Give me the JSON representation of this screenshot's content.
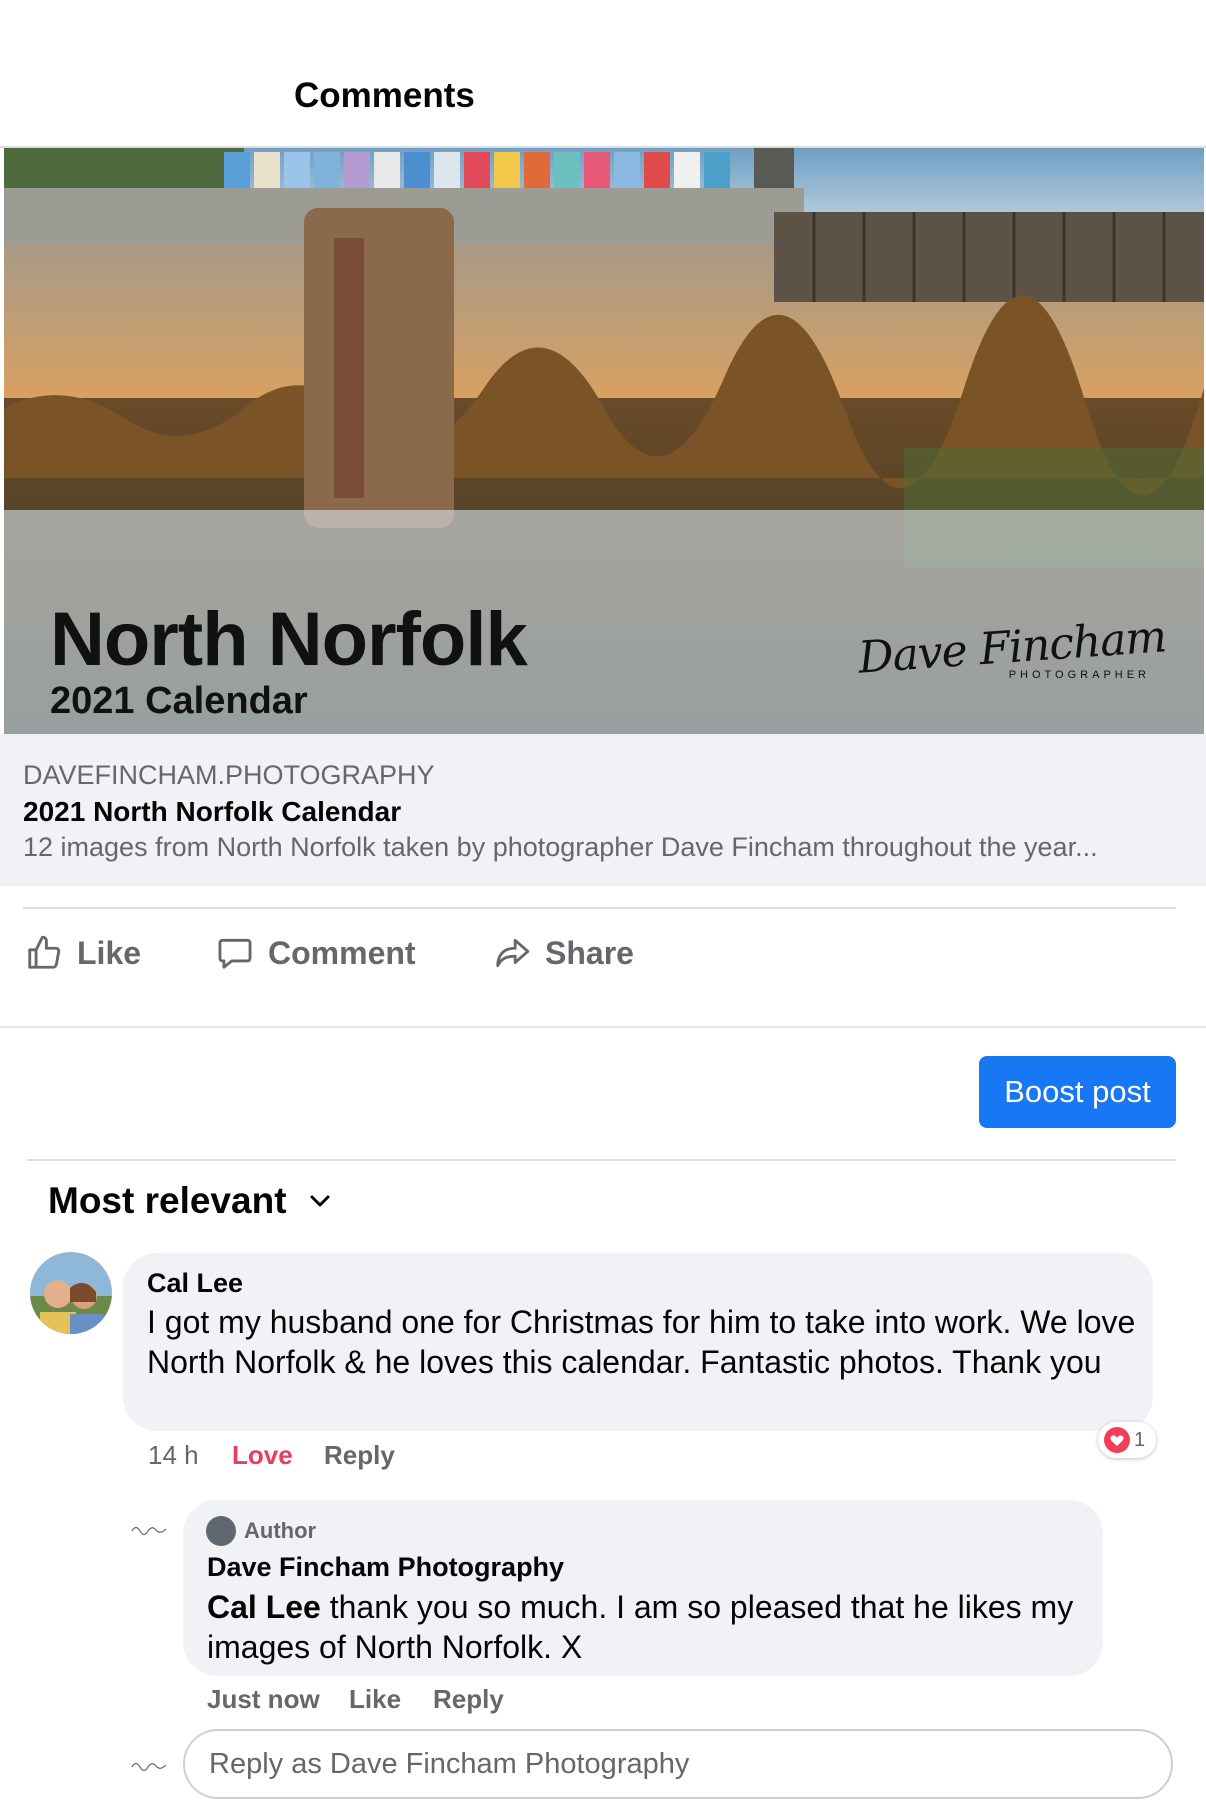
{
  "header": {
    "title": "Comments"
  },
  "preview": {
    "image_title": "North Norfolk",
    "image_subtitle": "2021 Calendar",
    "signature_name": "Dave Fincham",
    "signature_sub": "PHOTOGRAPHER",
    "domain": "DAVEFINCHAM.PHOTOGRAPHY",
    "title": "2021 North Norfolk Calendar",
    "description": "12 images from North Norfolk taken by photographer Dave Fincham throughout the year..."
  },
  "actions": {
    "like": "Like",
    "comment": "Comment",
    "share": "Share"
  },
  "boost": {
    "label": "Boost post"
  },
  "sort": {
    "label": "Most relevant"
  },
  "comments": [
    {
      "author": "Cal Lee",
      "text": "I got my husband one for Christmas for him to take into work. We love North Norfolk & he loves this calendar. Fantastic photos. Thank you",
      "time": "14 h",
      "reaction_label": "Love",
      "reply_label": "Reply",
      "reaction_count": "1",
      "reaction_color": "#f33e58"
    },
    {
      "badge": "Author",
      "author": "Dave Fincham Photography",
      "mention": "Cal Lee",
      "text": " thank you so much. I am so pleased that he likes my images of North Norfolk. X",
      "time": "Just now",
      "like_label": "Like",
      "reply_label": "Reply"
    }
  ],
  "reply_box": {
    "placeholder": "Reply as Dave Fincham Photography"
  },
  "colors": {
    "accent": "#1877f2",
    "love": "#e4405f",
    "secondary_text": "#65676b"
  }
}
